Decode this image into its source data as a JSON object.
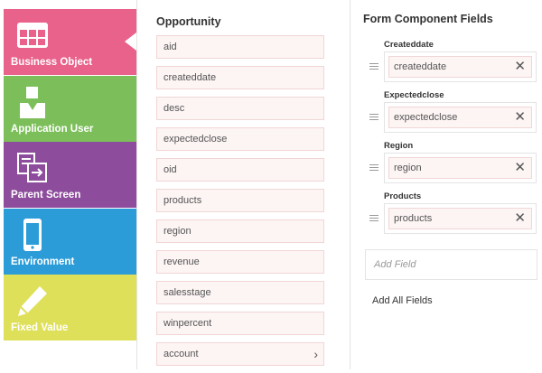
{
  "nav": {
    "items": [
      {
        "label": "Business Object",
        "icon": "table-icon",
        "color": "#e9628b",
        "selected": true
      },
      {
        "label": "Application User",
        "icon": "user-icon",
        "color": "#7cbf5a"
      },
      {
        "label": "Parent Screen",
        "icon": "screens-icon",
        "color": "#8d4c9c"
      },
      {
        "label": "Environment",
        "icon": "mobile-device-icon",
        "color": "#2b9cd8"
      },
      {
        "label": "Fixed Value",
        "icon": "pencil-icon",
        "color": "#dfe059"
      }
    ]
  },
  "opportunity": {
    "title": "Opportunity",
    "fields": [
      "aid",
      "createddate",
      "desc",
      "expectedclose",
      "oid",
      "products",
      "region",
      "revenue",
      "salesstage",
      "winpercent",
      "account"
    ]
  },
  "form": {
    "title": "Form Component Fields",
    "fields": [
      {
        "label": "Createddate",
        "value": "createddate"
      },
      {
        "label": "Expectedclose",
        "value": "expectedclose"
      },
      {
        "label": "Region",
        "value": "region"
      },
      {
        "label": "Products",
        "value": "products"
      }
    ],
    "add_field_placeholder": "Add Field",
    "add_all_label": "Add All Fields",
    "remove_glyph": "✕"
  },
  "chevron_glyph": "›"
}
